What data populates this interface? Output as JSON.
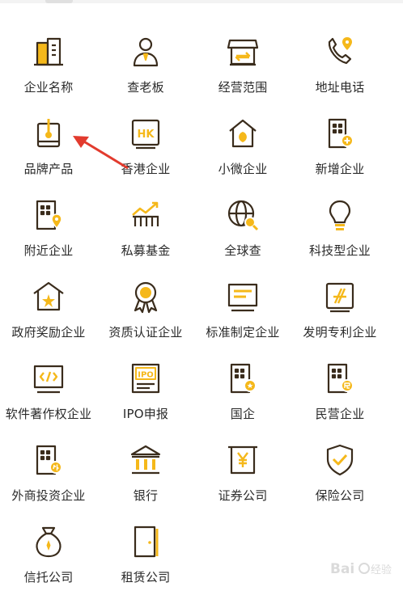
{
  "colors": {
    "accent": "#f5b81a",
    "ink": "#3a2c1c",
    "label": "#2a2a2a",
    "annotation": "#e23b2e"
  },
  "items": [
    {
      "label": "企业名称",
      "icon": "building-icon"
    },
    {
      "label": "查老板",
      "icon": "person-icon"
    },
    {
      "label": "经营范围",
      "icon": "storefront-icon"
    },
    {
      "label": "地址电话",
      "icon": "phone-location-icon"
    },
    {
      "label": "品牌产品",
      "icon": "brand-product-icon"
    },
    {
      "label": "香港企业",
      "icon": "hk-badge-icon"
    },
    {
      "label": "小微企业",
      "icon": "small-business-icon"
    },
    {
      "label": "新增企业",
      "icon": "new-company-icon"
    },
    {
      "label": "附近企业",
      "icon": "nearby-company-icon"
    },
    {
      "label": "私募基金",
      "icon": "fund-chart-icon"
    },
    {
      "label": "全球查",
      "icon": "globe-search-icon"
    },
    {
      "label": "科技型企业",
      "icon": "lightbulb-icon"
    },
    {
      "label": "政府奖励企业",
      "icon": "government-award-icon"
    },
    {
      "label": "资质认证企业",
      "icon": "certification-medal-icon"
    },
    {
      "label": "标准制定企业",
      "icon": "standard-doc-icon"
    },
    {
      "label": "发明专利企业",
      "icon": "patent-icon"
    },
    {
      "label": "软件著作权企业",
      "icon": "software-code-icon"
    },
    {
      "label": "IPO申报",
      "icon": "ipo-icon"
    },
    {
      "label": "国企",
      "icon": "state-owned-icon"
    },
    {
      "label": "民营企业",
      "icon": "private-company-icon"
    },
    {
      "label": "外商投资企业",
      "icon": "foreign-investment-icon"
    },
    {
      "label": "银行",
      "icon": "bank-icon"
    },
    {
      "label": "证券公司",
      "icon": "securities-icon"
    },
    {
      "label": "保险公司",
      "icon": "insurance-shield-icon"
    },
    {
      "label": "信托公司",
      "icon": "money-bag-icon"
    },
    {
      "label": "租赁公司",
      "icon": "door-icon"
    }
  ],
  "watermark": {
    "text": "Bai",
    "suffix": "经验"
  }
}
